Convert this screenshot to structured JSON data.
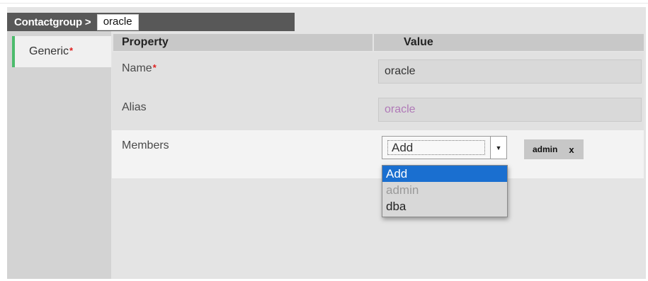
{
  "breadcrumb": {
    "label": "Contactgroup",
    "separator": ">",
    "value": "oracle"
  },
  "sidebar": {
    "tabs": [
      {
        "label": "Generic",
        "required_mark": "*"
      }
    ]
  },
  "table": {
    "headers": {
      "property": "Property",
      "value": "Value"
    },
    "rows": {
      "name": {
        "label": "Name",
        "required_mark": "*",
        "value": "oracle"
      },
      "alias": {
        "label": "Alias",
        "value": "oracle"
      },
      "members": {
        "label": "Members",
        "select_value": "Add",
        "options": [
          "Add",
          "admin",
          "dba"
        ],
        "tags": [
          {
            "label": "admin",
            "remove": "x"
          }
        ]
      }
    }
  },
  "colors": {
    "accent_green": "#4cbb6c",
    "selection_blue": "#1a6fd0",
    "required_red": "#e0201f",
    "alias_text": "#b07ab8"
  }
}
